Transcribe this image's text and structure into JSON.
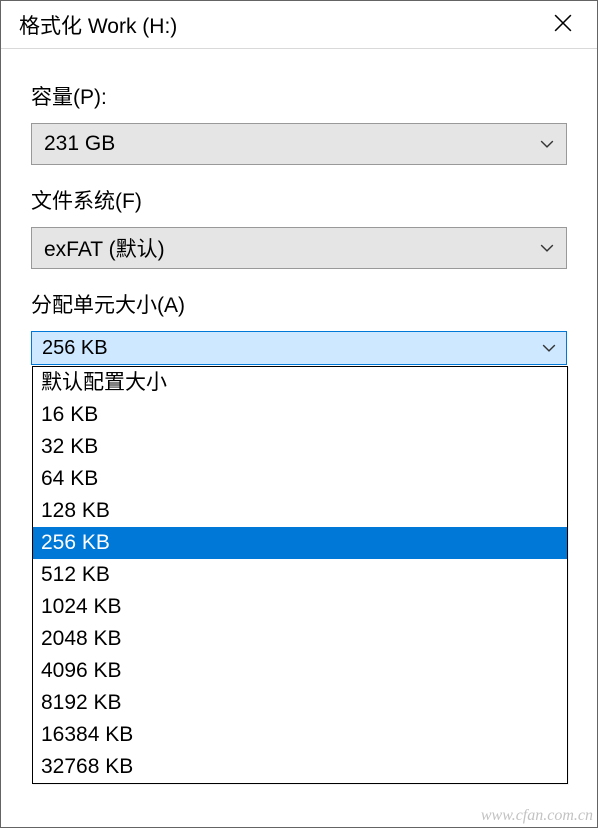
{
  "title": "格式化 Work (H:)",
  "capacity": {
    "label": "容量(P):",
    "value": "231 GB"
  },
  "filesystem": {
    "label": "文件系统(F)",
    "value": "exFAT (默认)"
  },
  "allocation": {
    "label": "分配单元大小(A)",
    "value": "256 KB",
    "options": [
      "默认配置大小",
      "16 KB",
      "32 KB",
      "64 KB",
      "128 KB",
      "256 KB",
      "512 KB",
      "1024 KB",
      "2048 KB",
      "4096 KB",
      "8192 KB",
      "16384 KB",
      "32768 KB"
    ],
    "selected_index": 5
  },
  "watermark": "www.cfan.com.cn"
}
